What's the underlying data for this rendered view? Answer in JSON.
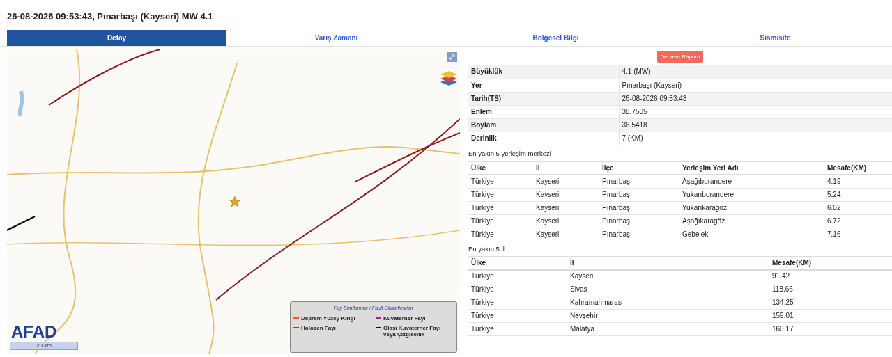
{
  "title": "26-08-2026 09:53:43, Pınarbaşı (Kayseri) MW 4.1",
  "tabs": [
    {
      "label": "Detay",
      "selected": true
    },
    {
      "label": "Varış Zamanı",
      "selected": false
    },
    {
      "label": "Bölgesel Bilgi",
      "selected": false
    },
    {
      "label": "Sismisite",
      "selected": false
    }
  ],
  "map": {
    "logo": "AFAD",
    "scale": "20 km",
    "legend": {
      "title": "Fay Sınıflaması / Fault Classification",
      "items": [
        {
          "label": "Deprem Yüzey Kırığı",
          "color": "#e8601c"
        },
        {
          "label": "Kuvaterner Fayı",
          "color": "#a3238e"
        },
        {
          "label": "Holosen Fayı",
          "color": "#c0282d"
        },
        {
          "label": "Olası Kuvaterner Fayı veya Çizgisellik",
          "color": "#111111"
        }
      ]
    }
  },
  "report_button": "Deprem Raporu",
  "details": [
    {
      "label": "Büyüklük",
      "value": "4.1 (MW)"
    },
    {
      "label": "Yer",
      "value": "Pınarbaşı (Kayseri)"
    },
    {
      "label": "Tarih(TS)",
      "value": "26-08-2026 09:53:43"
    },
    {
      "label": "Enlem",
      "value": "38.7505"
    },
    {
      "label": "Boylam",
      "value": "36.5418"
    },
    {
      "label": "Derinlik",
      "value": "7 (KM)"
    }
  ],
  "settlements": {
    "heading": "En yakın 5 yerleşim merkezi",
    "columns": [
      "Ülke",
      "İl",
      "İlçe",
      "Yerleşim Yeri Adı",
      "Mesafe(KM)"
    ],
    "rows": [
      [
        "Türkiye",
        "Kayseri",
        "Pınarbaşı",
        "Aşağıborandere",
        "4.19"
      ],
      [
        "Türkiye",
        "Kayseri",
        "Pınarbaşı",
        "Yukarıborandere",
        "5.24"
      ],
      [
        "Türkiye",
        "Kayseri",
        "Pınarbaşı",
        "Yukarıkaragöz",
        "6.02"
      ],
      [
        "Türkiye",
        "Kayseri",
        "Pınarbaşı",
        "Aşağıkaragöz",
        "6.72"
      ],
      [
        "Türkiye",
        "Kayseri",
        "Pınarbaşı",
        "Gebelek",
        "7.16"
      ]
    ]
  },
  "provinces": {
    "heading": "En yakın 5 il",
    "columns": [
      "Ülke",
      "İl",
      "Mesafe(KM)"
    ],
    "rows": [
      [
        "Türkiye",
        "Kayseri",
        "91.42"
      ],
      [
        "Türkiye",
        "Sivas",
        "118.66"
      ],
      [
        "Türkiye",
        "Kahramanmaraş",
        "134.25"
      ],
      [
        "Türkiye",
        "Nevşehir",
        "159.01"
      ],
      [
        "Türkiye",
        "Malatya",
        "160.17"
      ]
    ]
  }
}
